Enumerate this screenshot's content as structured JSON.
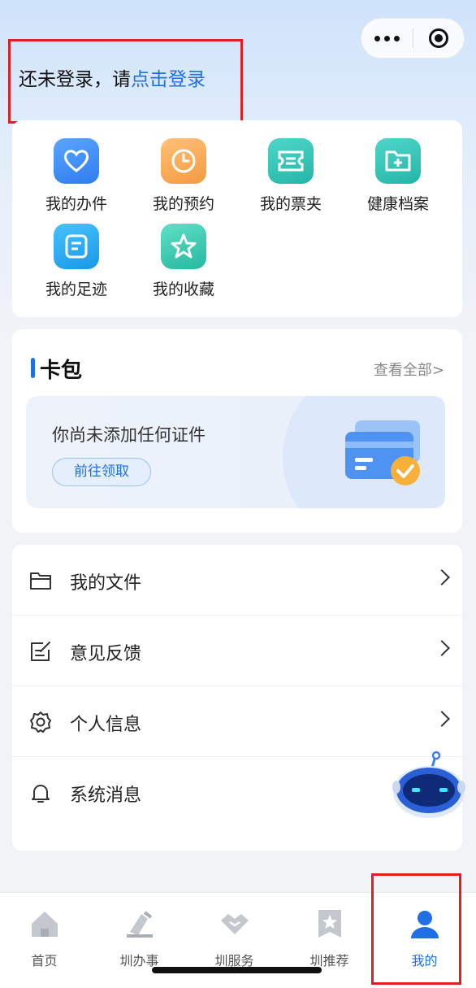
{
  "login": {
    "prefix": "还未登录，请",
    "link": "点击登录"
  },
  "quick_actions": [
    {
      "label": "我的办件",
      "icon": "heart-icon",
      "color": "#3b8ef5"
    },
    {
      "label": "我的预约",
      "icon": "clock-icon",
      "color": "#f6a14a"
    },
    {
      "label": "我的票夹",
      "icon": "ticket-icon",
      "color": "#2fc1b3"
    },
    {
      "label": "健康档案",
      "icon": "folder-plus-icon",
      "color": "#2fc1b3"
    },
    {
      "label": "我的足迹",
      "icon": "document-icon",
      "color": "#29a8ef"
    },
    {
      "label": "我的收藏",
      "icon": "star-icon",
      "color": "#34c9b0"
    }
  ],
  "wallet": {
    "title": "卡包",
    "view_all": "查看全部>",
    "empty_text": "你尚未添加任何证件",
    "go_button": "前往领取"
  },
  "menu": [
    {
      "label": "我的文件",
      "icon": "folder-icon"
    },
    {
      "label": "意见反馈",
      "icon": "feedback-icon"
    },
    {
      "label": "个人信息",
      "icon": "gear-icon"
    },
    {
      "label": "系统消息",
      "icon": "bell-icon"
    }
  ],
  "tabs": [
    {
      "label": "首页",
      "icon": "home-icon"
    },
    {
      "label": "圳办事",
      "icon": "stamp-icon"
    },
    {
      "label": "圳服务",
      "icon": "handshake-icon"
    },
    {
      "label": "圳推荐",
      "icon": "star-bookmark-icon"
    },
    {
      "label": "我的",
      "icon": "user-icon",
      "active": true
    }
  ],
  "colors": {
    "accent": "#1f6fe5",
    "highlight_box": "#e02020",
    "tab_inactive": "#c4c7cd"
  }
}
